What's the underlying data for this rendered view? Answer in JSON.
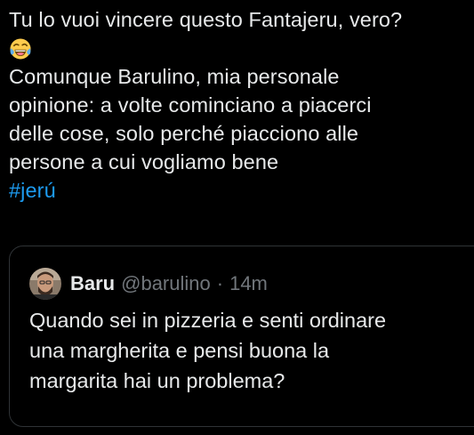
{
  "tweet": {
    "lines": [
      "Tu lo vuoi vincere questo Fantajeru, vero?",
      "Comunque Barulino, mia personale",
      "opinione: a volte cominciano a piacerci",
      "delle cose, solo perché piacciono alle",
      "persone a cui vogliamo bene"
    ],
    "emoji": "face-with-tears-of-joy",
    "hashtag": "#jerú"
  },
  "quote": {
    "name": "Baru",
    "handle": "@barulino",
    "separator": "·",
    "time": "14m",
    "avatar_icon": "user-avatar",
    "text_lines": [
      "Quando sei in pizzeria e senti ordinare",
      "una margherita e pensi buona la",
      "margarita hai un problema?"
    ]
  },
  "colors": {
    "background": "#000000",
    "text": "#e7e9ea",
    "secondary": "#71767b",
    "link": "#1d9bf0",
    "border": "#2f3336"
  }
}
